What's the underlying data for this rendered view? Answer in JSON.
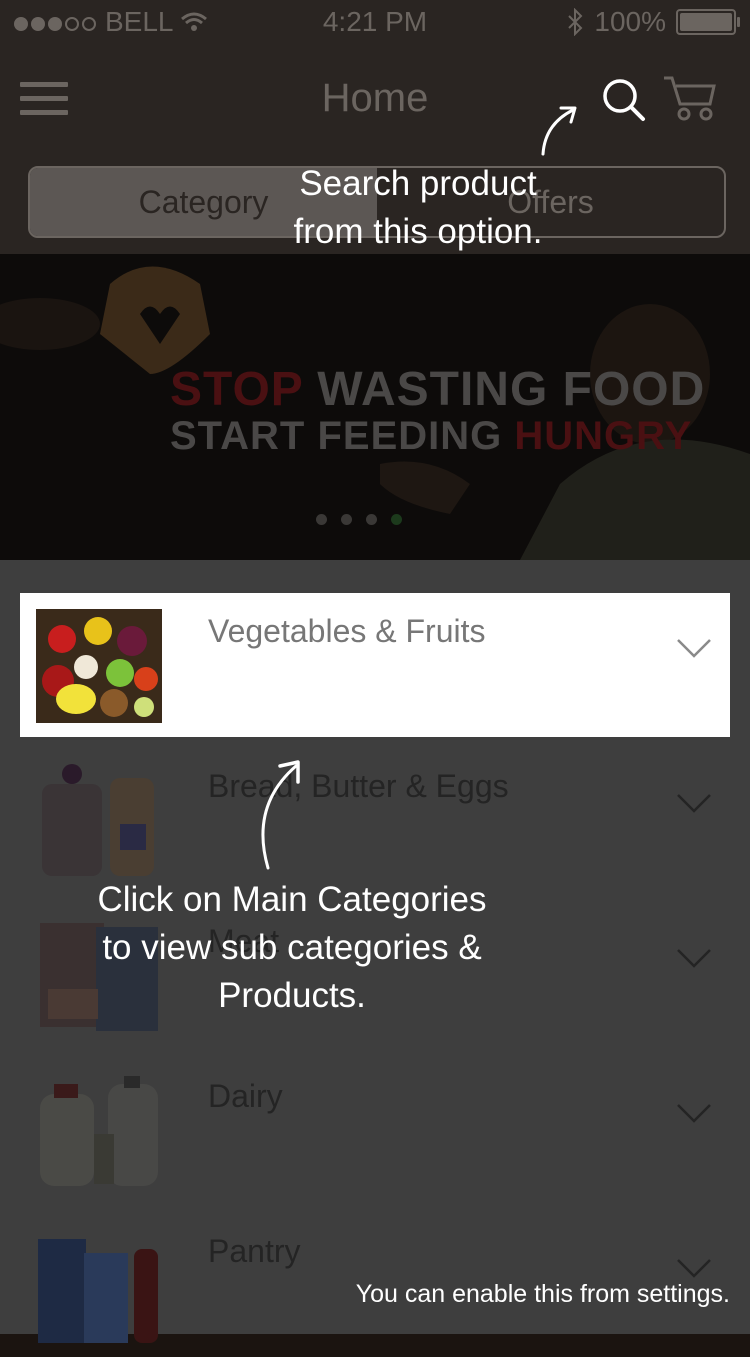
{
  "status_bar": {
    "carrier": "BELL",
    "time": "4:21 PM",
    "battery": "100%"
  },
  "header": {
    "title": "Home",
    "tabs": [
      {
        "label": "Category",
        "active": true
      },
      {
        "label": "Offers",
        "active": false
      }
    ]
  },
  "banner": {
    "line1_a": "STOP",
    "line1_b": "WASTING FOOD",
    "line2_a": "START FEEDING",
    "line2_b": "HUNGRY",
    "page_count": 4,
    "active_page": 4
  },
  "categories": [
    {
      "label": "Vegetables & Fruits",
      "thumb": "vegetables-fruits-thumbnail"
    },
    {
      "label": "Bread, Butter & Eggs",
      "thumb": "bread-thumbnail"
    },
    {
      "label": "Meat",
      "thumb": "meat-thumbnail"
    },
    {
      "label": "Dairy",
      "thumb": "dairy-thumbnail"
    },
    {
      "label": "Pantry",
      "thumb": "pantry-thumbnail"
    }
  ],
  "tips": {
    "search_line1": "Search product",
    "search_line2": "from this option.",
    "categories_line1": "Click on Main Categories",
    "categories_line2": "to view sub categories &",
    "categories_line3": "Products.",
    "footer_note": "You can enable this from settings."
  },
  "colors": {
    "overlay_dim": "#3e3e3e",
    "highlight_row": "#ffffff",
    "tip_text": "#ffffff"
  }
}
